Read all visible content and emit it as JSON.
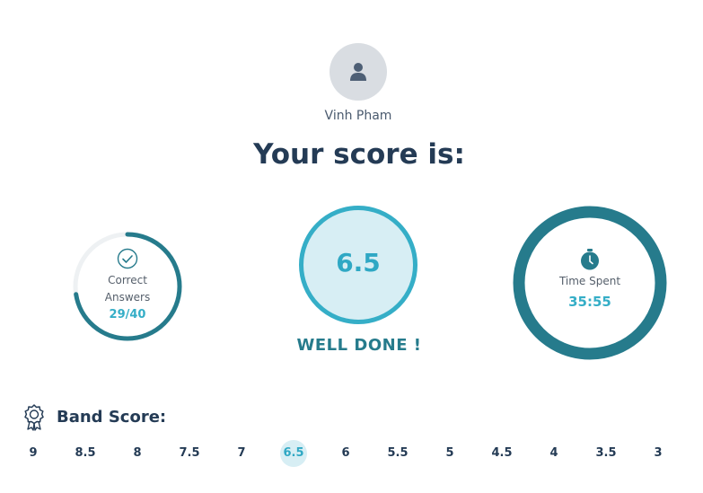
{
  "user": {
    "name": "Vinh Pham",
    "avatar_icon": "user-icon"
  },
  "heading": "Your score is:",
  "correct": {
    "label_line1": "Correct",
    "label_line2": "Answers",
    "value": "29/40",
    "correct": 29,
    "total": 40,
    "icon": "check-circle-icon"
  },
  "score": {
    "value": "6.5",
    "message": "WELL DONE !"
  },
  "time": {
    "label": "Time Spent",
    "value": "35:55",
    "icon": "stopwatch-icon"
  },
  "band": {
    "title": "Band Score:",
    "icon": "award-ribbon-icon",
    "items": [
      "9",
      "8.5",
      "8",
      "7.5",
      "7",
      "6.5",
      "6",
      "5.5",
      "5",
      "4.5",
      "4",
      "3.5",
      "3"
    ],
    "selected": "6.5"
  },
  "colors": {
    "dark": "#243b55",
    "teal": "#267b8c",
    "accent": "#35aec7",
    "light": "#d7eef4"
  }
}
